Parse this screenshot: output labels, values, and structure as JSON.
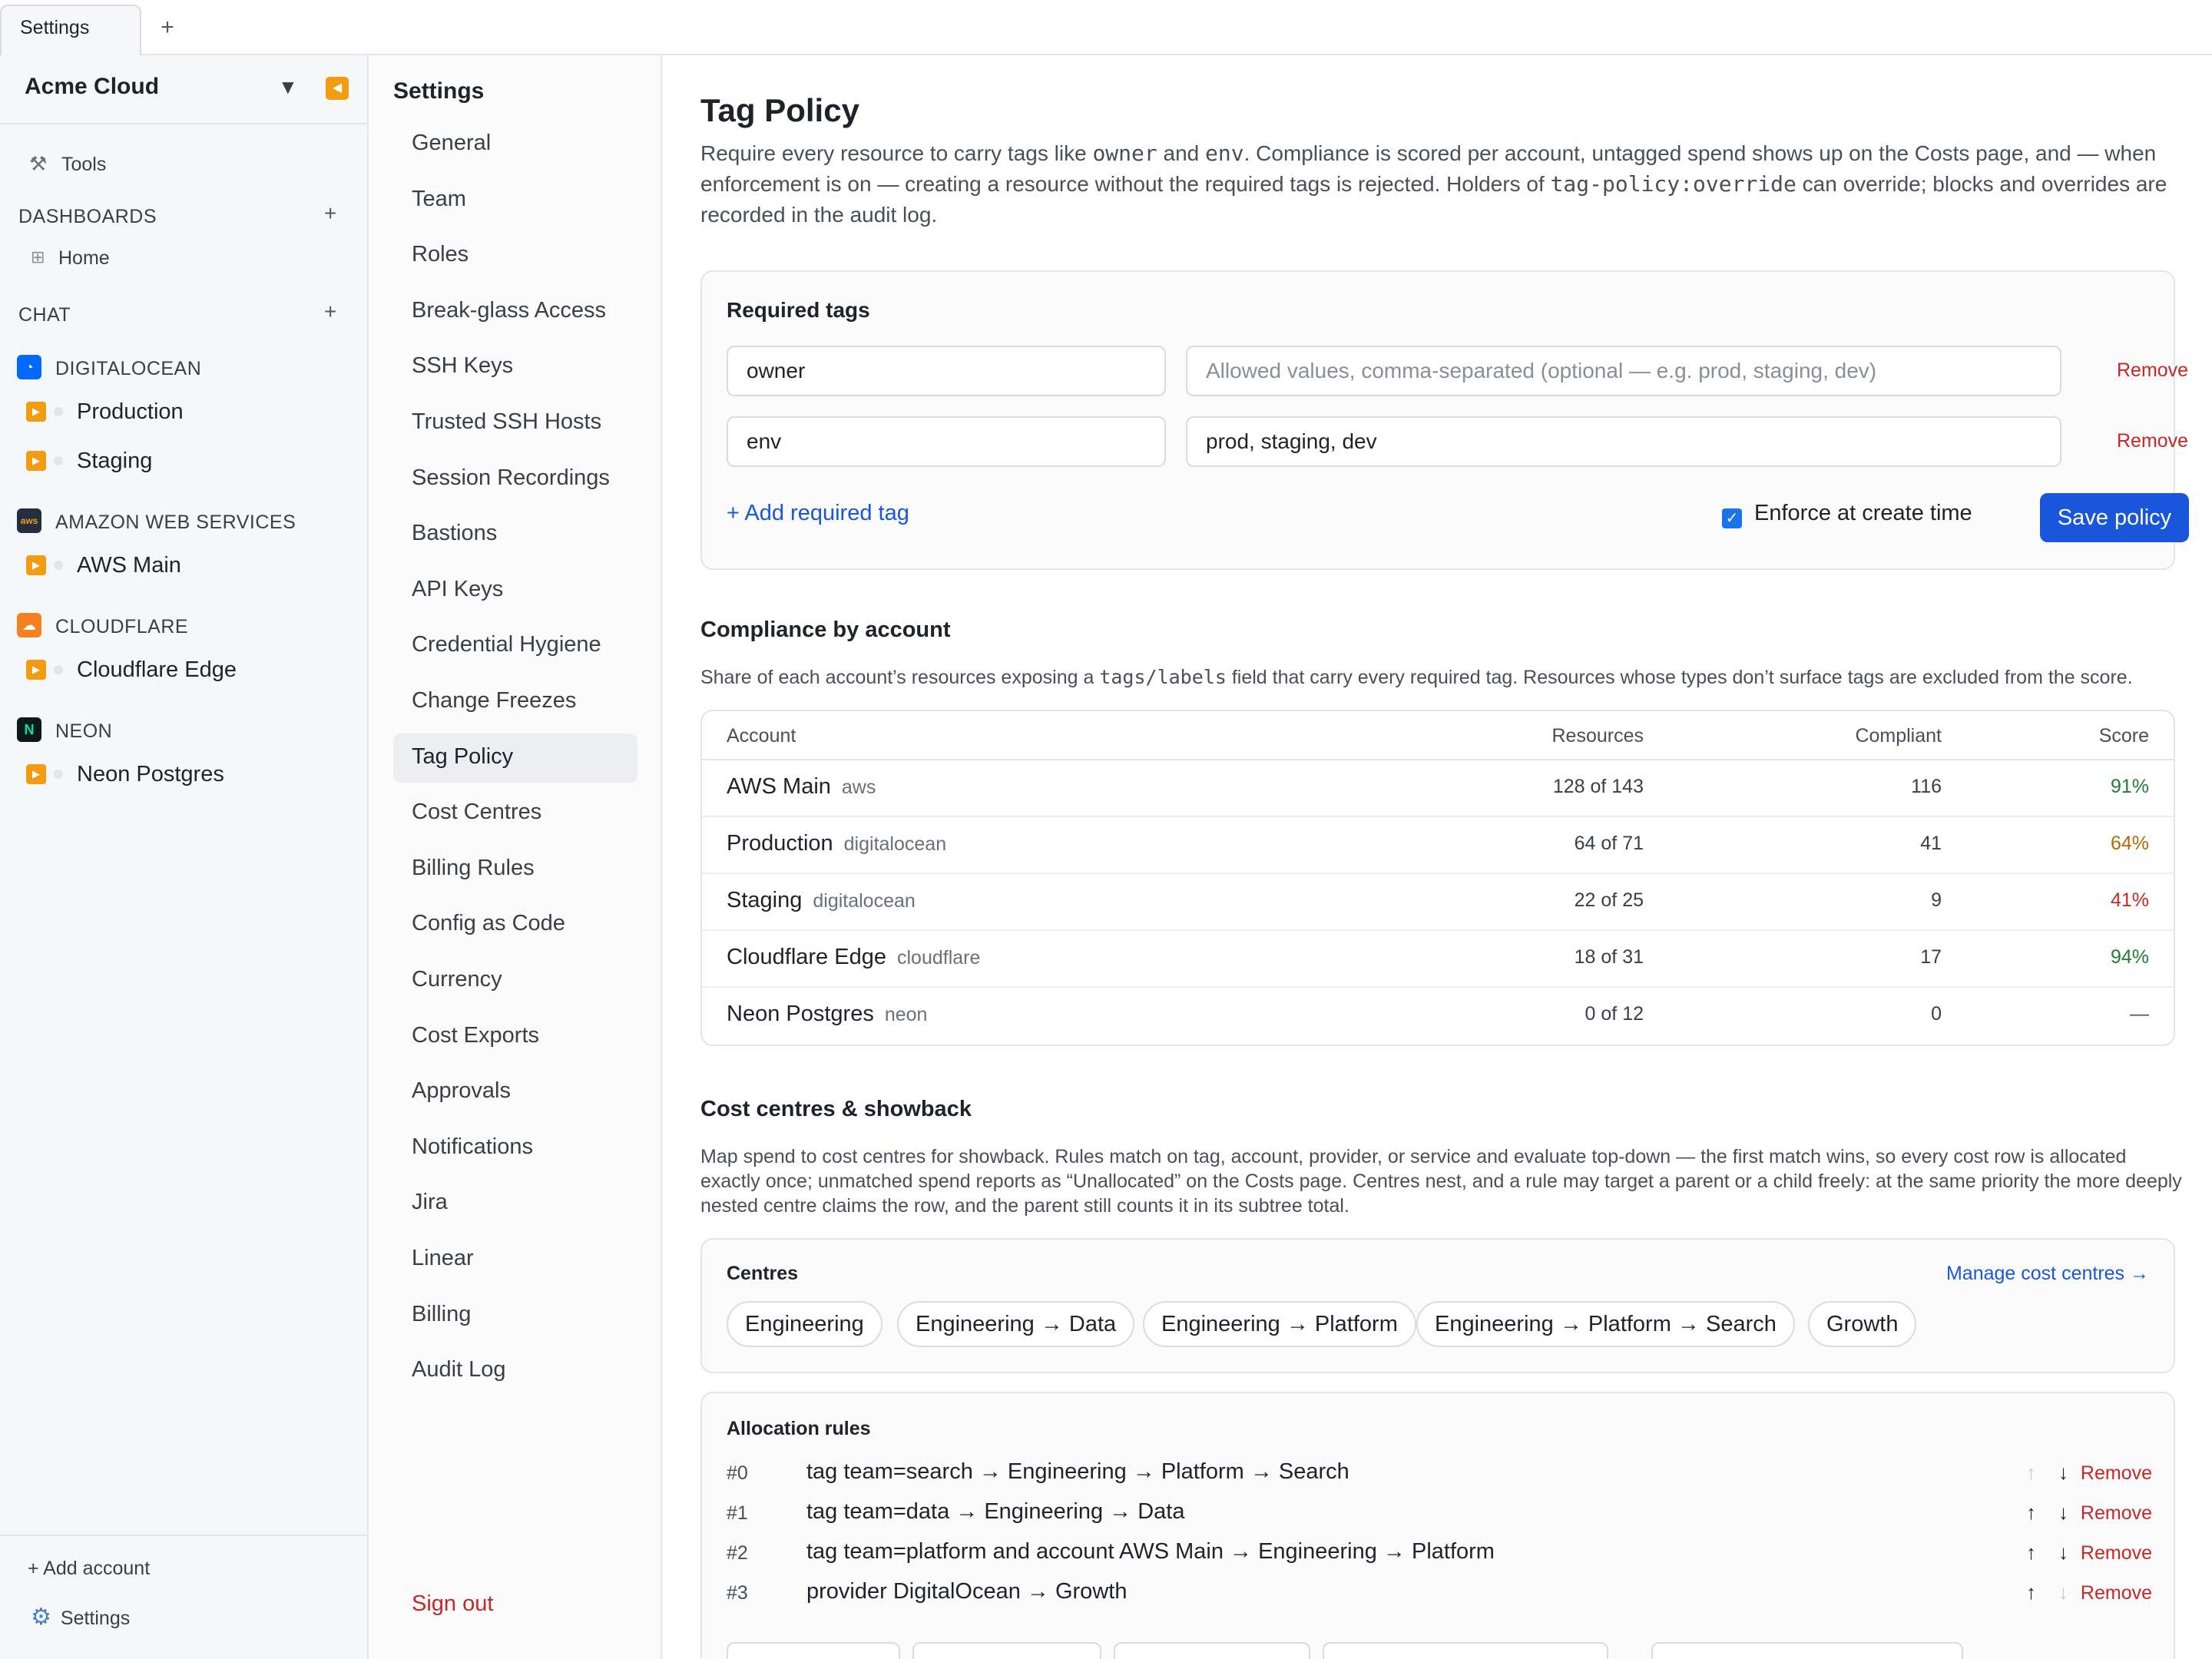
{
  "tabs": {
    "active_label": "Settings",
    "add_label": "+"
  },
  "sidebar": {
    "org_name": "Acme Cloud",
    "caret": "▼",
    "collapse": "◀",
    "tools_label": "Tools",
    "dashboards_head": "DASHBOARDS",
    "home_label": "Home",
    "chat_head": "CHAT",
    "plus": "+",
    "providers": [
      {
        "name": "DIGITALOCEAN",
        "logo": "digitalocean-logo",
        "color": "#0069ff",
        "accounts": [
          "Production",
          "Staging"
        ]
      },
      {
        "name": "AMAZON WEB SERVICES",
        "logo": "aws-logo",
        "color": "#232f3e",
        "accounts": [
          "AWS Main"
        ]
      },
      {
        "name": "CLOUDFLARE",
        "logo": "cloudflare-logo",
        "color": "#f48120",
        "accounts": [
          "Cloudflare Edge"
        ]
      },
      {
        "name": "NEON",
        "logo": "neon-logo",
        "color": "#00e599",
        "accounts": [
          "Neon Postgres"
        ]
      }
    ],
    "add_account": "+ Add account",
    "settings_label": "Settings"
  },
  "settings_nav": {
    "title": "Settings",
    "items": [
      "General",
      "Team",
      "Roles",
      "Break-glass Access",
      "SSH Keys",
      "Trusted SSH Hosts",
      "Session Recordings",
      "Bastions",
      "API Keys",
      "Credential Hygiene",
      "Change Freezes",
      "Tag Policy",
      "Cost Centres",
      "Billing Rules",
      "Config as Code",
      "Currency",
      "Cost Exports",
      "Approvals",
      "Notifications",
      "Jira",
      "Linear",
      "Billing",
      "Audit Log"
    ],
    "active": "Tag Policy",
    "sign_out": "Sign out"
  },
  "main": {
    "title": "Tag Policy",
    "desc_1": "Require every resource to carry tags like ",
    "desc_code1": "owner",
    "desc_2": " and ",
    "desc_code2": "env",
    "desc_3": ". Compliance is scored per account, untagged spend shows up on the Costs page, and — when enforcement is on — creating a resource without the required tags is rejected. Holders of ",
    "desc_code3": "tag-policy:override",
    "desc_4": " can override; blocks and overrides are recorded in the audit log.",
    "required_tags": {
      "title": "Required tags",
      "rows": [
        {
          "key": "owner",
          "values": "",
          "placeholder": "Allowed values, comma-separated (optional — e.g. prod, staging, dev)"
        },
        {
          "key": "env",
          "values": "prod, staging, dev",
          "placeholder": "Allowed values, comma-separated (optional — e.g. prod, staging, dev)"
        }
      ],
      "remove_label": "Remove",
      "add_label": "+ Add required tag",
      "enforce_label": "Enforce at create time",
      "enforce_checked": true,
      "save_label": "Save policy"
    },
    "compliance": {
      "title": "Compliance by account",
      "desc_1": "Share of each account’s resources exposing a ",
      "desc_code": "tags/labels",
      "desc_2": " field that carry every required tag. Resources whose types don’t surface tags are excluded from the score.",
      "headers": {
        "account": "Account",
        "resources": "Resources",
        "compliant": "Compliant",
        "score": "Score"
      },
      "rows": [
        {
          "account": "AWS Main",
          "provider": "aws",
          "resources": "128 of 143",
          "compliant": "116",
          "score": "91%",
          "score_color": "#1e7e34"
        },
        {
          "account": "Production",
          "provider": "digitalocean",
          "resources": "64 of 71",
          "compliant": "41",
          "score": "64%",
          "score_color": "#b26a00"
        },
        {
          "account": "Staging",
          "provider": "digitalocean",
          "resources": "22 of 25",
          "compliant": "9",
          "score": "41%",
          "score_color": "#c62828"
        },
        {
          "account": "Cloudflare Edge",
          "provider": "cloudflare",
          "resources": "18 of 31",
          "compliant": "17",
          "score": "94%",
          "score_color": "#1e7e34"
        },
        {
          "account": "Neon Postgres",
          "provider": "neon",
          "resources": "0 of 12",
          "compliant": "0",
          "score": "—",
          "score_color": "#4a4f57"
        }
      ]
    },
    "cost_centres": {
      "title": "Cost centres & showback",
      "desc": "Map spend to cost centres for showback. Rules match on tag, account, provider, or service and evaluate top-down — the first match wins, so every cost row is allocated exactly once; unmatched spend reports as “Unallocated” on the Costs page. Centres nest, and a rule may target a parent or a child freely: at the same priority the more deeply nested centre claims the row, and the parent still counts it in its subtree total.",
      "centres_title": "Centres",
      "manage_link": "Manage cost centres →",
      "centres": [
        "Engineering",
        "Engineering → Data",
        "Engineering → Platform",
        "Engineering → Platform → Search",
        "Growth"
      ],
      "rules_title": "Allocation rules",
      "rules": [
        {
          "num": "#0",
          "text": "tag team=search → Engineering → Platform → Search",
          "up_enabled": false,
          "down_enabled": true
        },
        {
          "num": "#1",
          "text": "tag team=data → Engineering → Data",
          "up_enabled": true,
          "down_enabled": true
        },
        {
          "num": "#2",
          "text": "tag team=platform and account AWS Main → Engineering → Platform",
          "up_enabled": true,
          "down_enabled": true
        },
        {
          "num": "#3",
          "text": "provider DigitalOcean → Growth",
          "up_enabled": true,
          "down_enabled": false
        }
      ],
      "remove_label": "Remove",
      "up_arrow": "↑",
      "down_arrow": "↓"
    }
  }
}
